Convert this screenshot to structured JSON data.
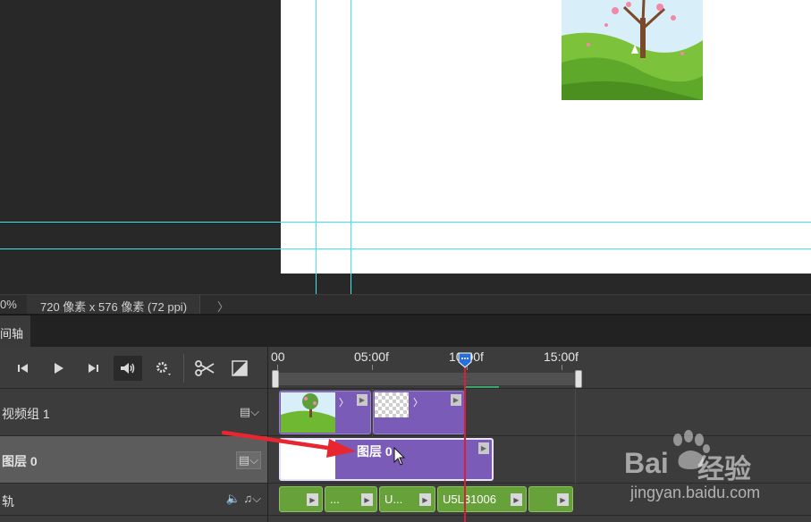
{
  "status_bar": {
    "zoom": "0%",
    "doc_size": "720 像素 x 576 像素 (72 ppi)",
    "more_arrow": "〉"
  },
  "panel": {
    "tab_label": "间轴"
  },
  "controls": {
    "prev_frame_icon": "step-back-icon",
    "play_icon": "play-icon",
    "next_frame_icon": "step-forward-icon",
    "audio_icon": "speaker-icon",
    "settings_icon": "gear-icon",
    "split_icon": "scissors-icon",
    "transition_icon": "transition-icon"
  },
  "ruler": {
    "ticks": [
      "00",
      "05:00f",
      "10:00f",
      "15:00f"
    ]
  },
  "tracks": {
    "video_group": {
      "label": "视频组 1",
      "tool": "▤⌵"
    },
    "layer0": {
      "label": "图层 0",
      "tool": "▤⌵"
    },
    "audio": {
      "label": "轨",
      "tool": "🔈 ♫⌵"
    }
  },
  "clips": {
    "video_arrow_1": "〉",
    "video_arrow_2": "〉",
    "layer0_name": "图层 0",
    "audio": [
      "",
      "...",
      "U...",
      "U5L31006",
      ""
    ]
  },
  "watermark": {
    "brand": "Bai",
    "suffix": "经验",
    "url": "jingyan.baidu.com"
  },
  "colors": {
    "video_clip": "#7a5bb8",
    "audio_clip": "#67a13a",
    "playhead": "#d4203a",
    "guide": "#3fe6f0"
  }
}
